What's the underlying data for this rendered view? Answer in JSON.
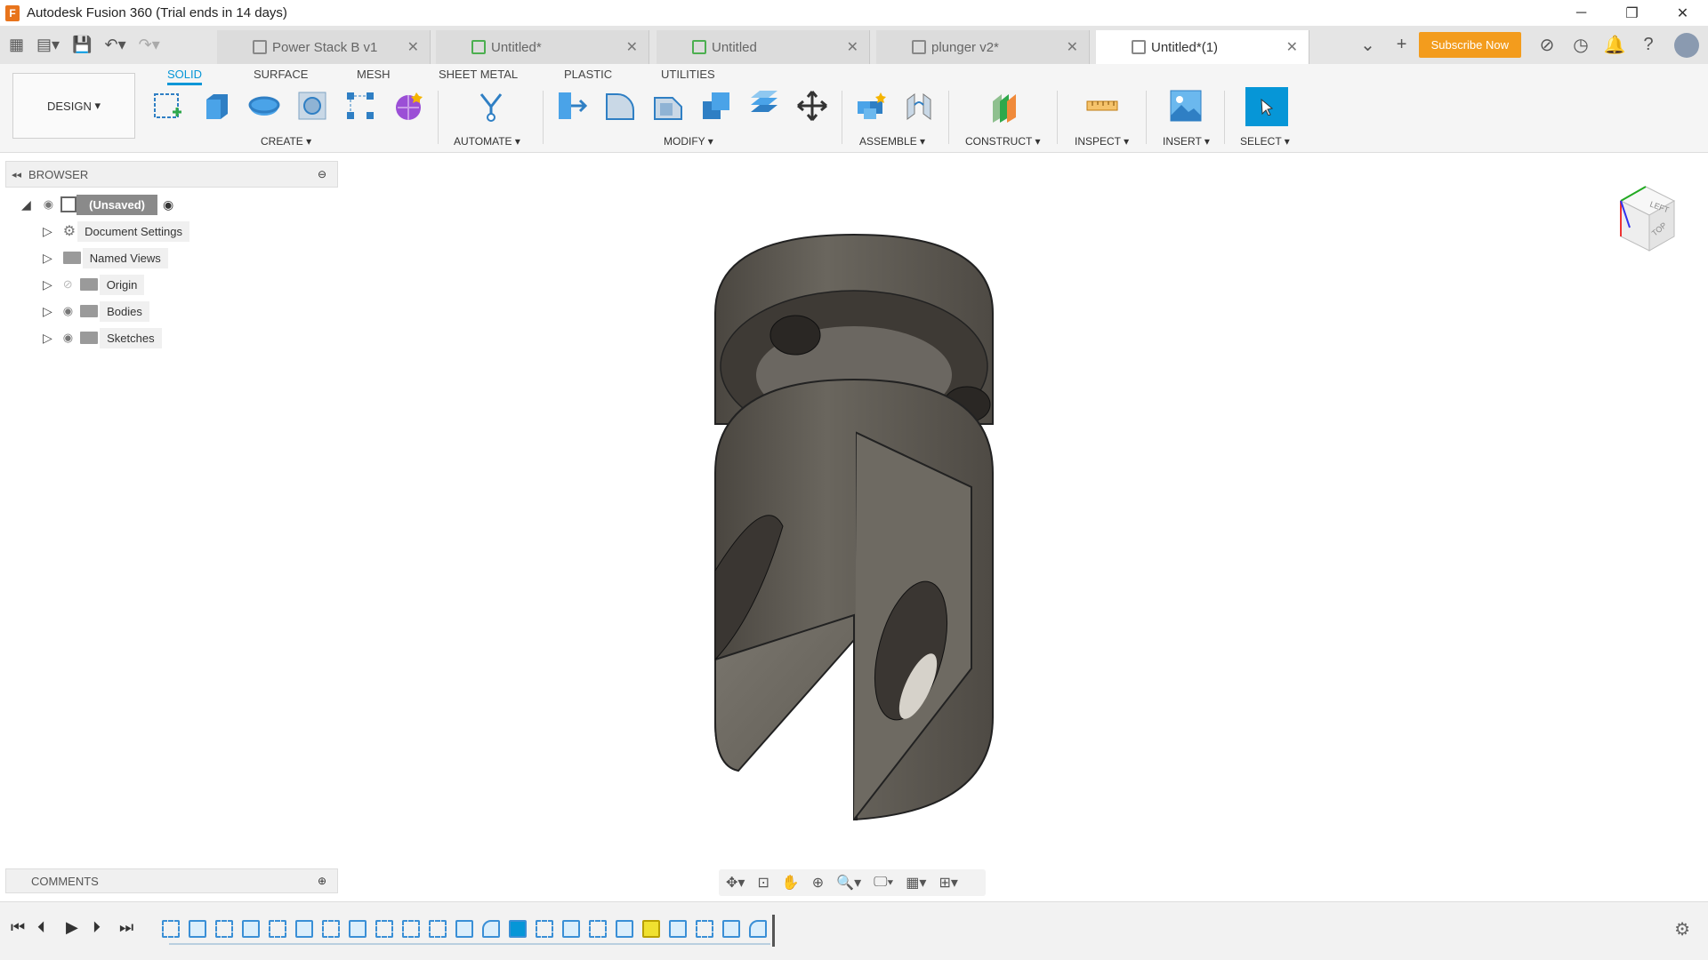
{
  "window": {
    "title": "Autodesk Fusion 360 (Trial ends in 14 days)",
    "minimize": "─",
    "maximize": "❐",
    "close": "✕"
  },
  "tabs": [
    {
      "label": "Power Stack B v1",
      "active": false
    },
    {
      "label": "Untitled*",
      "active": false
    },
    {
      "label": "Untitled",
      "active": false
    },
    {
      "label": "plunger v2*",
      "active": false
    },
    {
      "label": "Untitled*(1)",
      "active": true
    }
  ],
  "tabbar": {
    "subscribe": "Subscribe Now"
  },
  "toolbar": {
    "workspace": "DESIGN",
    "workspace_tabs": [
      "SOLID",
      "SURFACE",
      "MESH",
      "SHEET METAL",
      "PLASTIC",
      "UTILITIES"
    ],
    "groups": [
      "CREATE",
      "AUTOMATE",
      "MODIFY",
      "ASSEMBLE",
      "CONSTRUCT",
      "INSPECT",
      "INSERT",
      "SELECT"
    ]
  },
  "browser": {
    "header": "BROWSER",
    "root": "(Unsaved)",
    "items": [
      "Document Settings",
      "Named Views",
      "Origin",
      "Bodies",
      "Sketches"
    ]
  },
  "comments": {
    "header": "COMMENTS"
  },
  "viewcube": {
    "left": "LEFT",
    "top": "TOP"
  },
  "colors": {
    "accent": "#0696d7",
    "subscribe": "#f39c1d",
    "model": "#5a5650"
  }
}
